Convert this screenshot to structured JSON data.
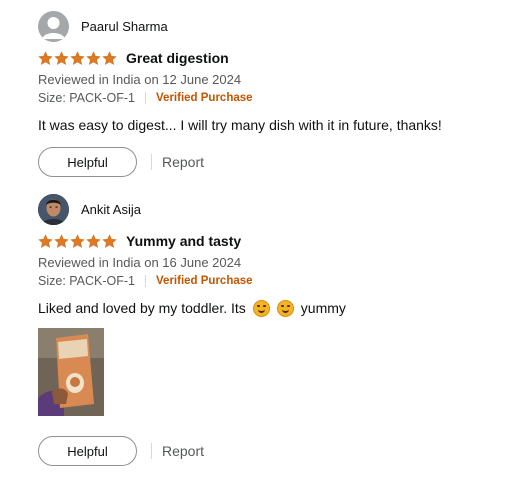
{
  "reviews": [
    {
      "profile_name": "Paarul Sharma",
      "avatar": "default-user-icon",
      "rating": 5,
      "title": "Great digestion",
      "reviewed": "Reviewed in India on 12 June 2024",
      "size": "Size: PACK-OF-1",
      "verified": "Verified Purchase",
      "body": "It was easy to digest... I will try many dish with it in future, thanks!",
      "helpful_label": "Helpful",
      "report_label": "Report"
    },
    {
      "profile_name": "Ankit Asija",
      "avatar": "user-photo",
      "rating": 5,
      "title": "Yummy and tasty",
      "reviewed": "Reviewed in India on 16 June 2024",
      "size": "Size: PACK-OF-1",
      "verified": "Verified Purchase",
      "body_start": "Liked and loved by my toddler. Its",
      "body_end": "yummy",
      "emoji": "yum-face-emoji",
      "helpful_label": "Helpful",
      "report_label": "Report"
    }
  ],
  "colors": {
    "star": "#de7921",
    "verified": "#c45500",
    "meta_text": "#565959"
  }
}
